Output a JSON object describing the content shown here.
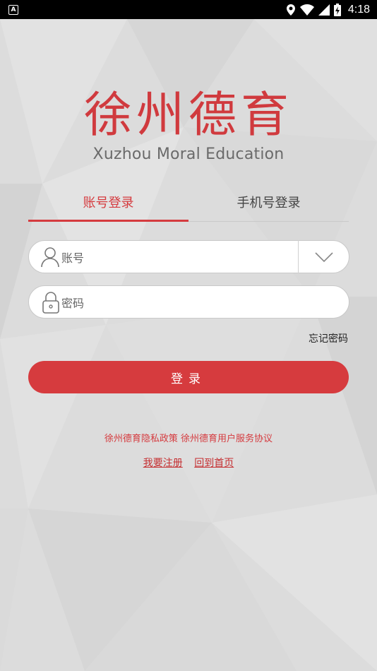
{
  "status_bar": {
    "badge": "A",
    "time": "4:18"
  },
  "logo": {
    "chinese": "徐州德育",
    "english": "Xuzhou Moral Education"
  },
  "tabs": [
    {
      "label": "账号登录",
      "active": true
    },
    {
      "label": "手机号登录",
      "active": false
    }
  ],
  "account_field": {
    "placeholder": "账号"
  },
  "password_field": {
    "placeholder": "密码"
  },
  "forgot_password": "忘记密码",
  "login_button": "登录",
  "policy_text": "徐州德育隐私政策 徐州德育用户服务协议",
  "links": {
    "register": "我要注册",
    "home": "回到首页"
  },
  "colors": {
    "accent": "#d63b3e",
    "background": "#dcdcdc"
  }
}
